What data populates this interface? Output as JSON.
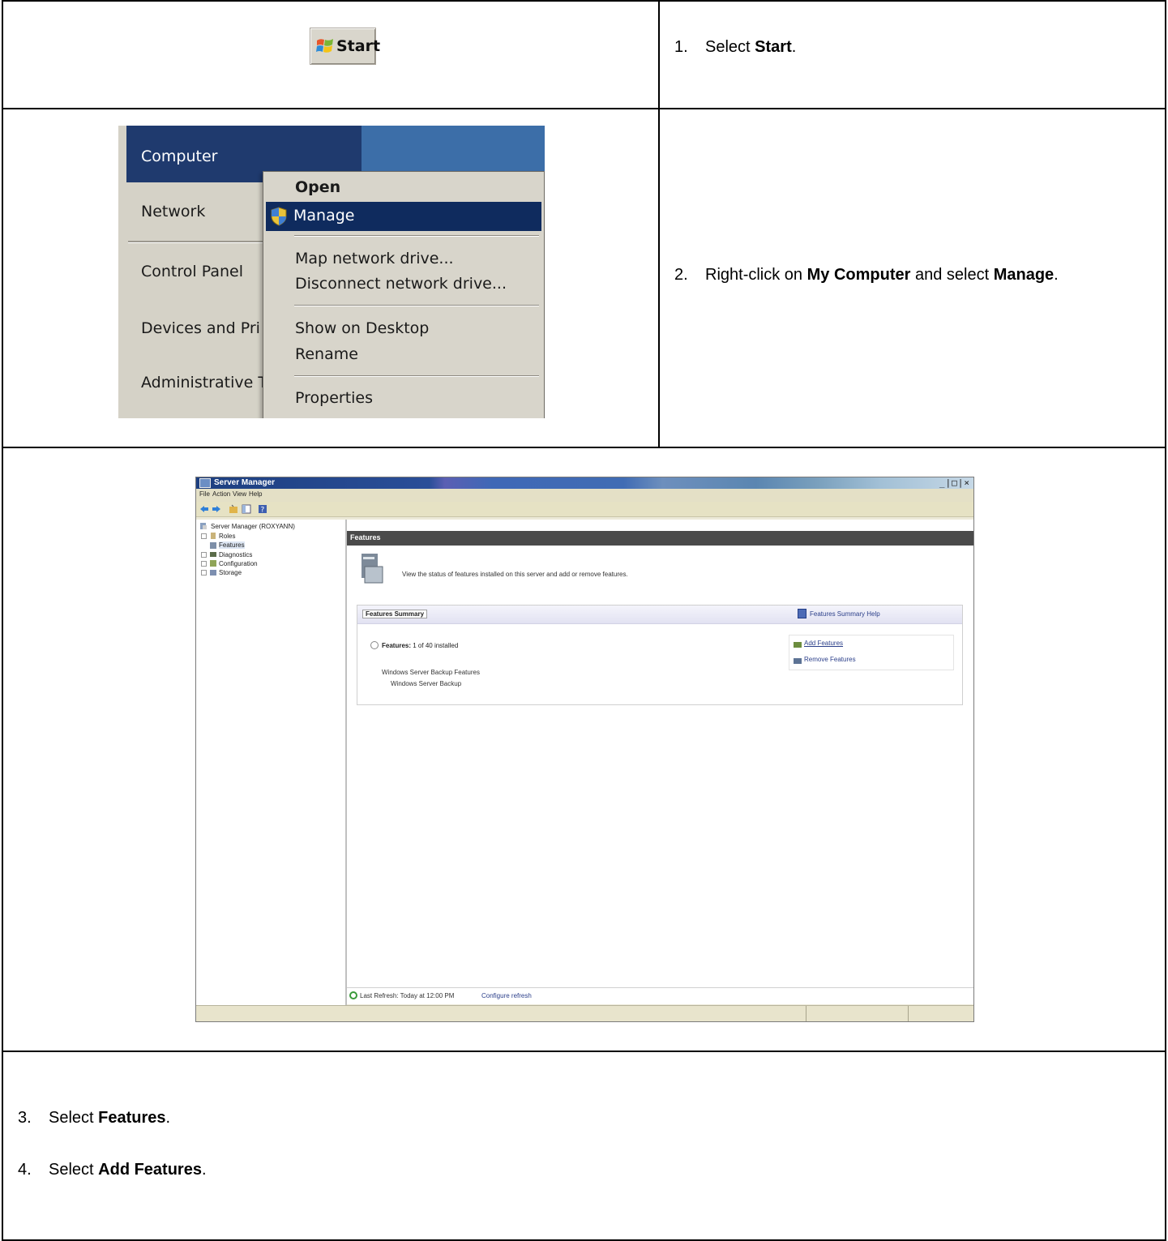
{
  "steps": [
    {
      "num": "1.",
      "pre": "Select ",
      "bold": "Start",
      "post": "."
    },
    {
      "num": "2.",
      "pre": "Right-click on ",
      "bold": "My Computer",
      "mid": " and select ",
      "bold2": "Manage",
      "post": "."
    },
    {
      "num": "3.",
      "pre": "Select ",
      "bold": "Features",
      "post": "."
    },
    {
      "num": "4.",
      "pre": "Select ",
      "bold": "Add Features",
      "post": "."
    }
  ],
  "start_button": {
    "label": "Start"
  },
  "start_menu": {
    "items": [
      "Computer",
      "Network",
      "Control Panel",
      "Devices and Pri",
      "Administrative T"
    ],
    "context_menu": [
      "Open",
      "Manage",
      "Map network drive...",
      "Disconnect network drive...",
      "Show on Desktop",
      "Rename",
      "Properties"
    ]
  },
  "server_manager": {
    "title": "Server Manager",
    "window_controls": "_|□|×",
    "menu": [
      "File",
      "Action",
      "View",
      "Help"
    ],
    "tree": [
      "Server Manager (ROXYANN)",
      "Roles",
      "Features",
      "Diagnostics",
      "Configuration",
      "Storage"
    ],
    "header": "Features",
    "description": "View the status of features installed on this server and add or remove features.",
    "summary_title": "Features Summary",
    "summary_help": "Features Summary Help",
    "features_label": "Features:",
    "features_count": "1 of 40 installed",
    "installed": [
      "Windows Server Backup Features",
      "Windows Server Backup"
    ],
    "actions": [
      "Add Features",
      "Remove Features"
    ],
    "last_refresh": "Last Refresh: Today at 12:00 PM",
    "configure_refresh": "Configure refresh"
  }
}
